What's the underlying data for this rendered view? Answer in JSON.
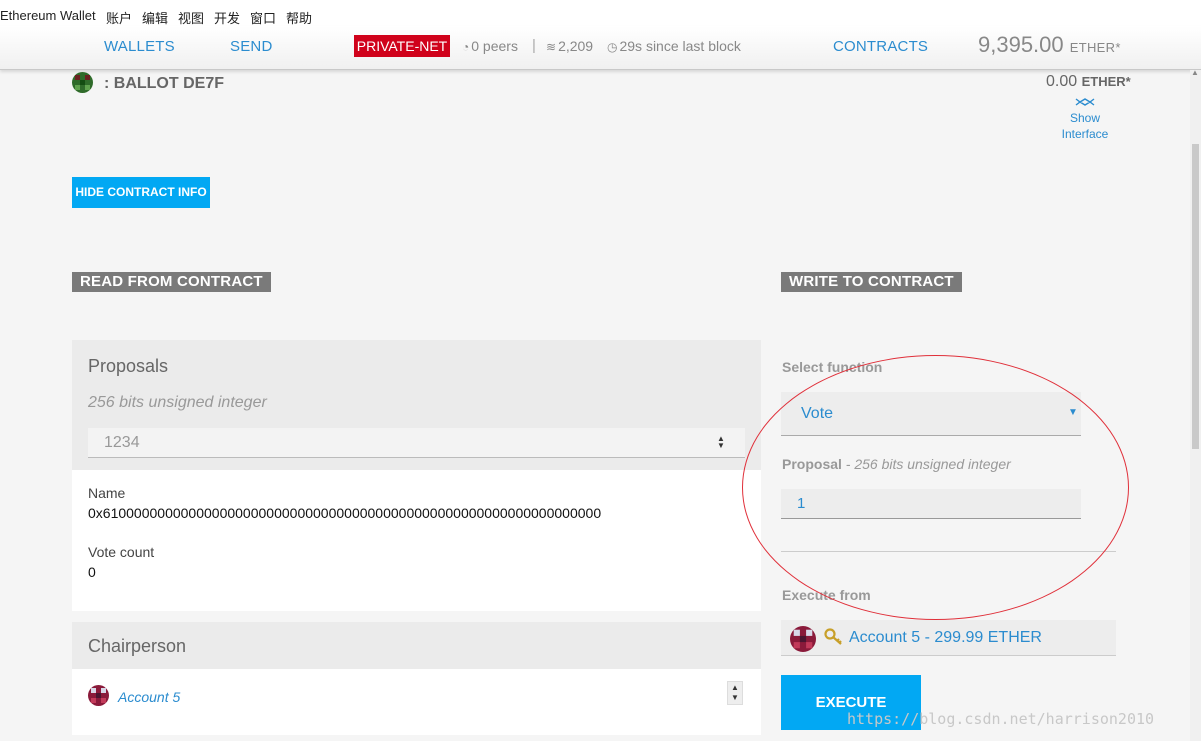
{
  "menubar": {
    "items": [
      "Ethereum Wallet",
      "账户",
      "编辑",
      "视图",
      "开发",
      "窗口",
      "帮助"
    ]
  },
  "nav": {
    "wallets": "WALLETS",
    "send": "SEND",
    "network": "PRIVATE-NET",
    "peers": "0 peers",
    "separator": "|",
    "blocks": "2,209",
    "since": "29s since last block",
    "contracts": "CONTRACTS",
    "balance": "9,395.00",
    "balance_unit": "ETHER*"
  },
  "contract": {
    "name": ": BALLOT DE7F",
    "balance": "0.00",
    "balance_unit": "ETHER*",
    "show_interface_1": "Show",
    "show_interface_2": "Interface",
    "hide_button": "HIDE CONTRACT INFO"
  },
  "read": {
    "title": "READ FROM CONTRACT",
    "proposals": {
      "title": "Proposals",
      "type": "256 bits unsigned integer",
      "input_value": "1234",
      "name_label": "Name",
      "name_value": "0x6100000000000000000000000000000000000000000000000000000000000000",
      "votes_label": "Vote count",
      "votes_value": "0"
    },
    "chairperson": {
      "title": "Chairperson",
      "account": "Account 5"
    }
  },
  "write": {
    "title": "WRITE TO CONTRACT",
    "select_label": "Select function",
    "selected_function": "Vote",
    "param_name": "Proposal",
    "param_type": "- 256 bits unsigned integer",
    "param_value": "1",
    "execute_from_label": "Execute from",
    "account": "Account 5 - 299.99 ETHER",
    "execute_button": "EXECUTE"
  },
  "watermark": "https://blog.csdn.net/harrison2010",
  "colors": {
    "accent": "#02a8f3",
    "link": "#2b8ccf",
    "network_badge": "#d0021b",
    "annotation": "#e0303a"
  }
}
